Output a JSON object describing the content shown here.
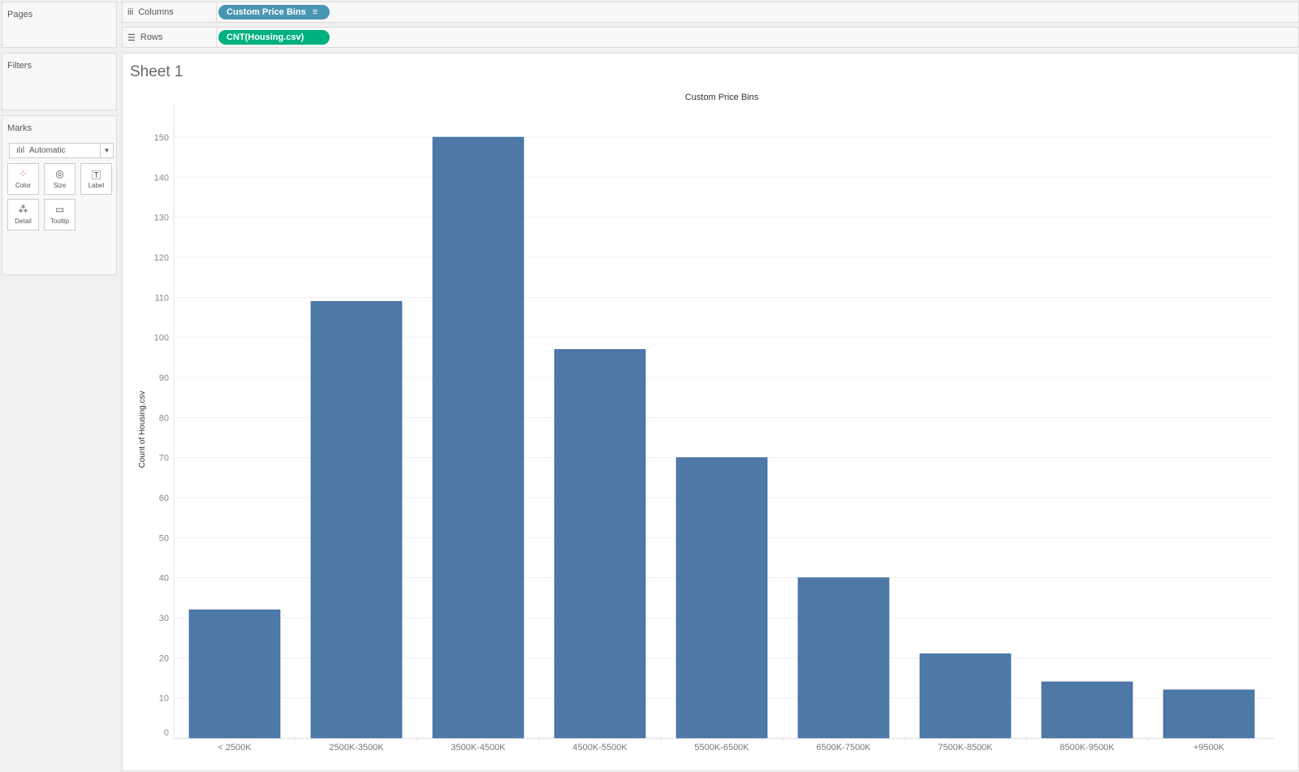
{
  "panels": {
    "pages": "Pages",
    "filters": "Filters",
    "marks": "Marks"
  },
  "marks": {
    "type": "Automatic",
    "cards": [
      "Color",
      "Size",
      "Label",
      "Detail",
      "Tooltip"
    ]
  },
  "shelves": {
    "columns_label": "Columns",
    "columns_pill": "Custom Price Bins",
    "rows_label": "Rows",
    "rows_pill": "CNT(Housing.csv)"
  },
  "colors": {
    "columns_pill": "#4996b2",
    "rows_pill": "#00b180",
    "bar": "#4e79a7"
  },
  "sheet_title": "Sheet 1",
  "chart_data": {
    "type": "bar",
    "title": "Custom Price Bins",
    "xlabel": "",
    "ylabel": "Count of Housing.csv",
    "categories": [
      "< 2500K",
      "2500K-3500K",
      "3500K-4500K",
      "4500K-5500K",
      "5500K-6500K",
      "6500K-7500K",
      "7500K-8500K",
      "8500K-9500K",
      "+9500K"
    ],
    "values": [
      32,
      109,
      150,
      97,
      70,
      40,
      21,
      14,
      12
    ],
    "yticks": [
      0,
      10,
      20,
      30,
      40,
      50,
      60,
      70,
      80,
      90,
      100,
      110,
      120,
      130,
      140,
      150
    ],
    "ylim": [
      0,
      150
    ],
    "grid": true
  }
}
